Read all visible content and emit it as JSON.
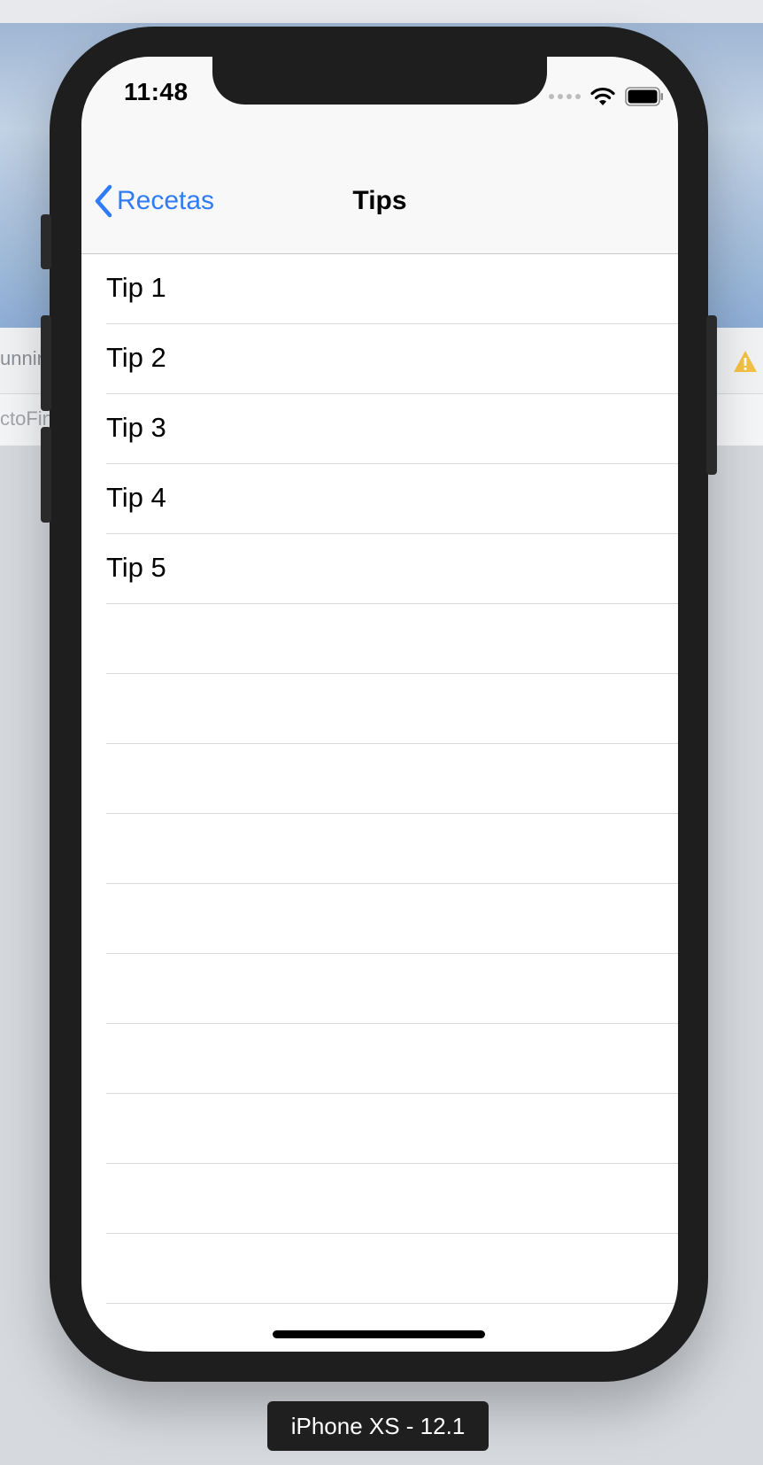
{
  "status_bar": {
    "time": "11:48"
  },
  "nav_bar": {
    "back_label": "Recetas",
    "title": "Tips"
  },
  "tips": [
    "Tip 1",
    "Tip 2",
    "Tip 3",
    "Tip 4",
    "Tip 5"
  ],
  "empty_rows": 11,
  "background": {
    "row1_text": "unnin",
    "row2_text": "ctoFin"
  },
  "simulator_label": "iPhone XS - 12.1",
  "colors": {
    "accent": "#2f7cf6",
    "device": "#1e1e1f",
    "separator": "#d9d9de",
    "warning": "#f3c244"
  }
}
